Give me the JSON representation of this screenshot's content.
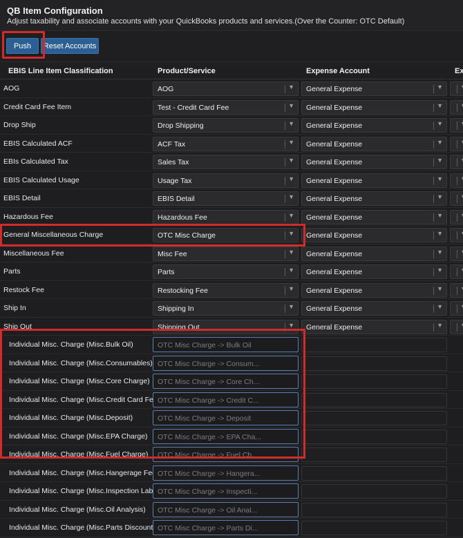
{
  "header": {
    "title": "QB Item Configuration",
    "subtitle": "Adjust taxability and associate accounts with your QuickBooks products and services.(Over the Counter: OTC Default)"
  },
  "toolbar": {
    "push_label": "Push",
    "reset_label": "Reset Accounts"
  },
  "columns": {
    "classification": "EBIS Line Item Classification",
    "product": "Product/Service",
    "expense": "Expense Account",
    "extra": "Ex"
  },
  "rows": [
    {
      "classification": "AOG",
      "product": "AOG",
      "expense": "General Expense"
    },
    {
      "classification": "Credit Card Fee Item",
      "product": "Test - Credit Card Fee",
      "expense": "General Expense"
    },
    {
      "classification": "Drop Ship",
      "product": "Drop Shipping",
      "expense": "General Expense"
    },
    {
      "classification": "EBIS Calculated ACF",
      "product": "ACF Tax",
      "expense": "General Expense"
    },
    {
      "classification": "EBIs Calculated Tax",
      "product": "Sales Tax",
      "expense": "General Expense"
    },
    {
      "classification": "EBIS Calculated Usage",
      "product": "Usage Tax",
      "expense": "General Expense"
    },
    {
      "classification": "EBIS Detail",
      "product": "EBIS Detail",
      "expense": "General Expense"
    },
    {
      "classification": "Hazardous Fee",
      "product": "Hazardous Fee",
      "expense": "General Expense"
    },
    {
      "classification": "General Miscellaneous Charge",
      "product": "OTC Misc Charge",
      "expense": "General Expense"
    },
    {
      "classification": "Miscellaneous Fee",
      "product": "Misc Fee",
      "expense": "General Expense"
    },
    {
      "classification": "Parts",
      "product": "Parts",
      "expense": "General Expense"
    },
    {
      "classification": "Restock Fee",
      "product": "Restocking Fee",
      "expense": "General Expense"
    },
    {
      "classification": "Ship In",
      "product": "Shipping In",
      "expense": "General Expense"
    },
    {
      "classification": "Ship Out",
      "product": "Shipping Out",
      "expense": "General Expense"
    }
  ],
  "individual_rows": [
    {
      "classification": "Individual Misc. Charge (Misc.Bulk Oil)",
      "placeholder": "OTC Misc Charge -> Bulk Oil"
    },
    {
      "classification": "Individual Misc. Charge (Misc.Consumables)",
      "placeholder": "OTC Misc Charge -> Consum..."
    },
    {
      "classification": "Individual Misc. Charge (Misc.Core Charge)",
      "placeholder": "OTC Misc Charge -> Core Ch..."
    },
    {
      "classification": "Individual Misc. Charge (Misc.Credit Card Fee)",
      "placeholder": "OTC Misc Charge -> Credit C..."
    },
    {
      "classification": "Individual Misc. Charge (Misc.Deposit)",
      "placeholder": "OTC Misc Charge -> Deposit"
    },
    {
      "classification": "Individual Misc. Charge (Misc.EPA Charge)",
      "placeholder": "OTC Misc Charge -> EPA Cha..."
    },
    {
      "classification": "Individual Misc. Charge (Misc.Fuel Charge)",
      "placeholder": "OTC Misc Charge -> Fuel Ch..."
    },
    {
      "classification": "Individual Misc. Charge (Misc.Hangerage Fee)",
      "placeholder": "OTC Misc Charge -> Hangera..."
    },
    {
      "classification": "Individual Misc. Charge (Misc.Inspection Labor",
      "placeholder": "OTC Misc Charge -> Inspecti..."
    },
    {
      "classification": "Individual Misc. Charge (Misc.Oil Analysis)",
      "placeholder": "OTC Misc Charge -> Oil Anal..."
    },
    {
      "classification": "Individual Misc. Charge (Misc.Parts Discount)",
      "placeholder": "OTC Misc Charge -> Parts Di..."
    }
  ],
  "icons": {
    "dropdown": "chevron-down-icon"
  },
  "colors": {
    "accent": "#2c5f93",
    "highlight": "#d42a2a",
    "background": "#1e1e20"
  }
}
